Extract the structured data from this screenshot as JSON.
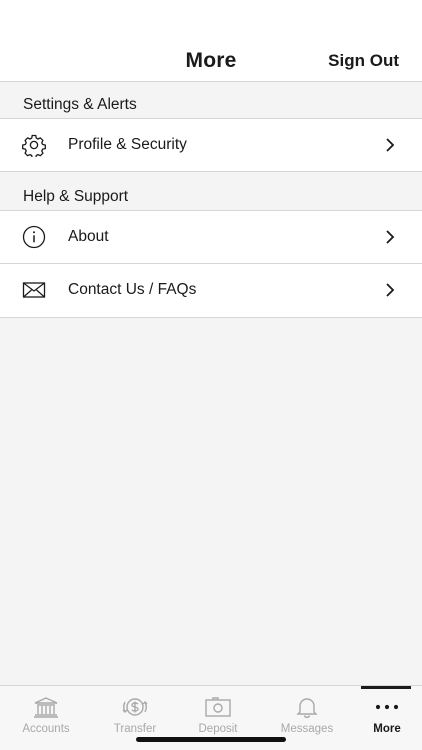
{
  "header": {
    "title": "More",
    "sign_out": "Sign Out"
  },
  "sections": [
    {
      "label": "Settings & Alerts",
      "items": [
        {
          "label": "Profile & Security",
          "icon": "gear-icon"
        }
      ]
    },
    {
      "label": "Help & Support",
      "items": [
        {
          "label": "About",
          "icon": "info-icon"
        },
        {
          "label": "Contact Us / FAQs",
          "icon": "envelope-icon"
        }
      ]
    }
  ],
  "tabbar": {
    "tabs": [
      {
        "label": "Accounts",
        "icon": "bank-icon",
        "active": false
      },
      {
        "label": "Transfer",
        "icon": "transfer-dollar-icon",
        "active": false
      },
      {
        "label": "Deposit",
        "icon": "camera-icon",
        "active": false
      },
      {
        "label": "Messages",
        "icon": "bell-icon",
        "active": false
      },
      {
        "label": "More",
        "icon": "more-dots-icon",
        "active": true
      }
    ]
  },
  "colors": {
    "text": "#1a1a1a",
    "inactive": "#a9a9a9",
    "divider": "#d6d6d6",
    "background": "#f4f4f4"
  }
}
